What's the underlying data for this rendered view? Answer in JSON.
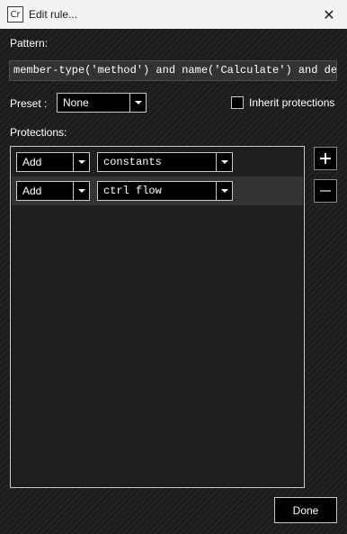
{
  "window": {
    "title": "Edit rule...",
    "app_icon": "Cr",
    "close_glyph": "✕"
  },
  "pattern": {
    "label": "Pattern:",
    "value": "member-type('method') and name('Calculate') and decl-type('Confuser.Test.Program')"
  },
  "preset": {
    "label": "Preset :",
    "value": "None",
    "inherit_label": "Inherit protections",
    "inherit_checked": false
  },
  "protections": {
    "label": "Protections:",
    "rows": [
      {
        "action": "Add",
        "protection": "constants",
        "selected": false
      },
      {
        "action": "Add",
        "protection": "ctrl flow",
        "selected": true
      }
    ],
    "add_icon": "plus-icon",
    "remove_icon": "minus-icon"
  },
  "footer": {
    "done_label": "Done"
  },
  "colors": {
    "titlebar": "#f3f3f3",
    "background": "#1c1c1c",
    "selected_row": "#333333",
    "border": "#c8c8c8"
  }
}
